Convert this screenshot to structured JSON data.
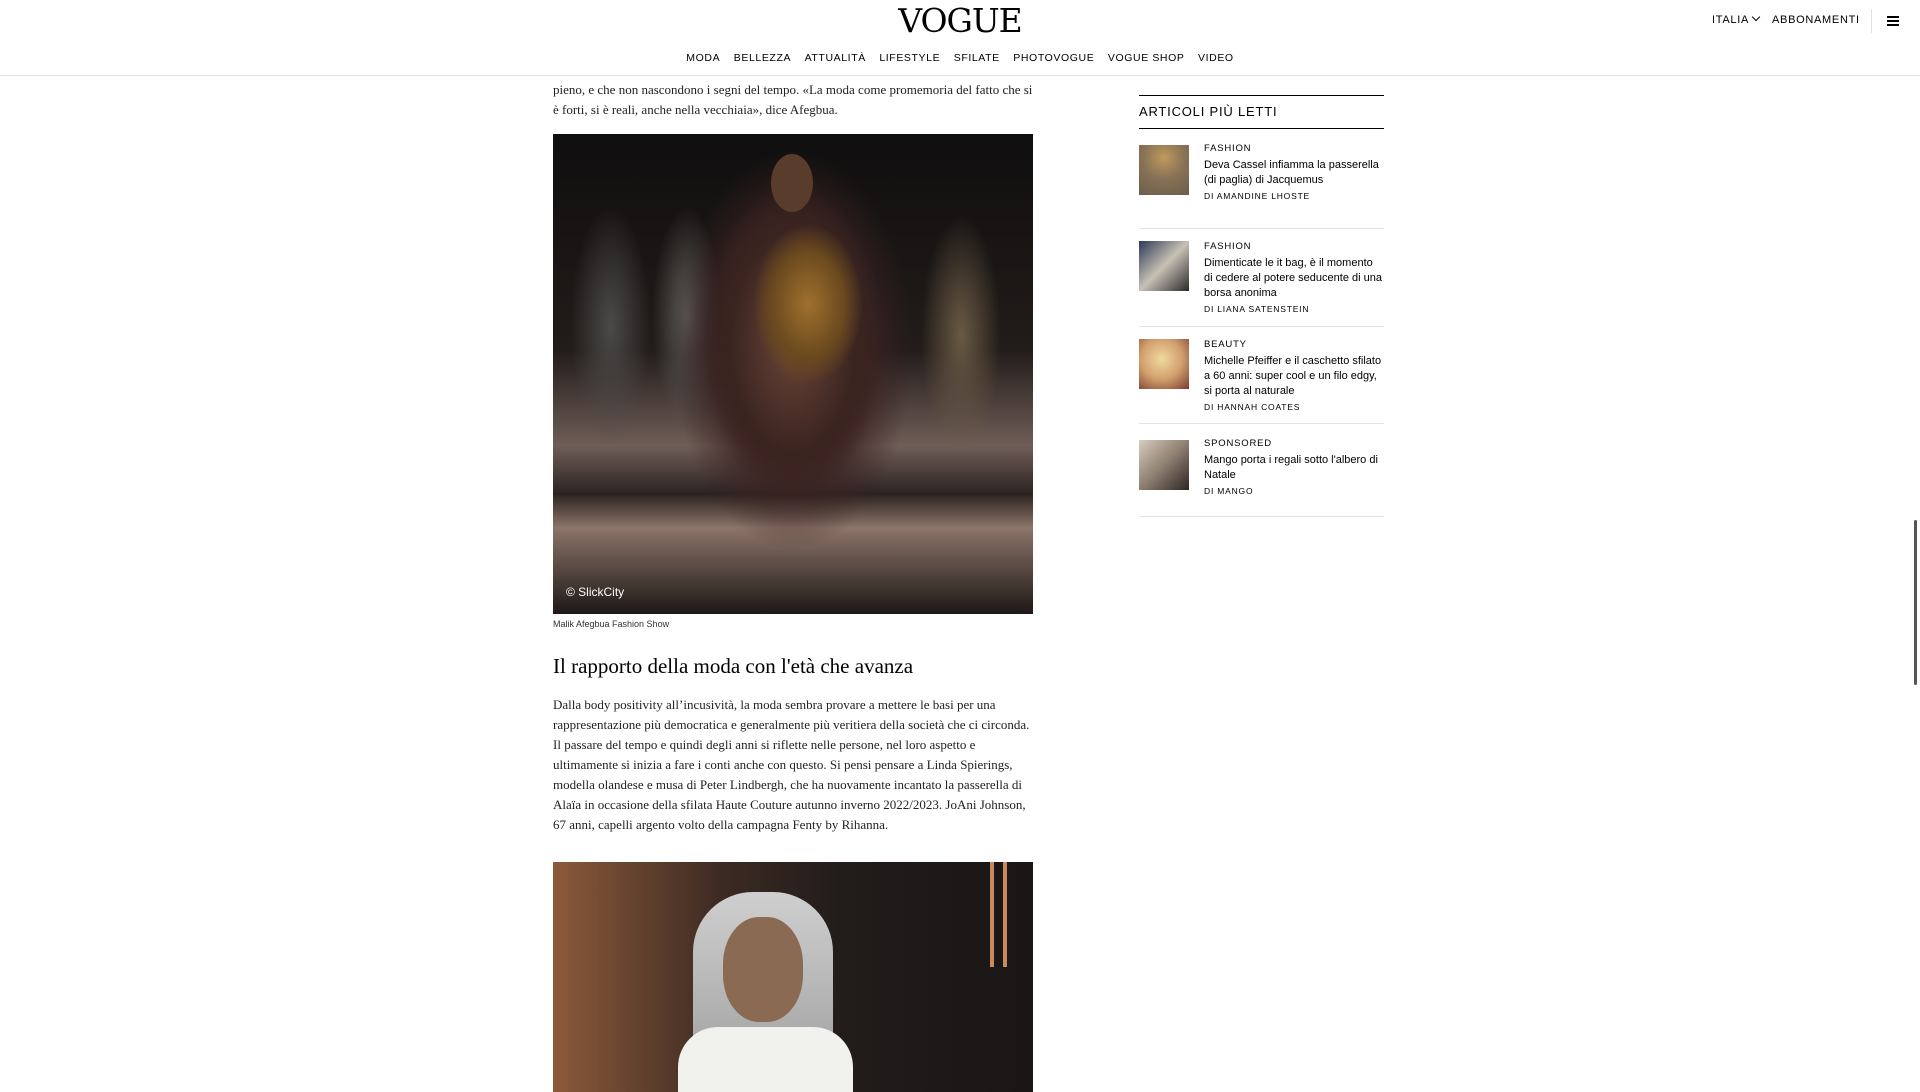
{
  "header": {
    "logo": "VOGUE",
    "country": "ITALIA",
    "subscribe": "ABBONAMENTI"
  },
  "nav": {
    "items": [
      "MODA",
      "BELLEZZA",
      "ATTUALITÀ",
      "LIFESTYLE",
      "SFILATE",
      "PHOTOVOGUE",
      "VOGUE SHOP",
      "VIDEO"
    ]
  },
  "article": {
    "intro_text": "pieno, e che non nascondono i segni del tempo. «La moda come promemoria del fatto che si è forti, si è reali, anche nella vecchiaia», dice Afegbua.",
    "photo1": {
      "credit": "© SlickCity",
      "caption": "Malik Afegbua Fashion Show"
    },
    "heading": "Il rapporto della moda con l'età che avanza",
    "paragraph": "Dalla body positivity all’incusività, la moda sembra provare a mettere le basi per una rappresentazione più democratica e generalmente più veritiera della società che ci circonda. Il passare del tempo e quindi degli anni si riflette nelle persone, nel loro aspetto e ultimamente si inizia a fare i conti anche con questo. Si pensi pensare a Linda Spierings, modella olandese e musa di Peter Lindbergh, che ha nuovamente incantato la passerella di Alaïa in occasione della sfilata Haute Couture autunno inverno 2022/2023. JoAni Johnson, 67 anni, capelli argento volto della campagna Fenty by Rihanna."
  },
  "sidebar": {
    "title": "ARTICOLI PIÙ LETTI",
    "items": [
      {
        "category": "FASHION",
        "title": "Deva Cassel infiamma la passerella (di paglia) di Jacquemus",
        "author": "DI AMANDINE LHOSTE"
      },
      {
        "category": "FASHION",
        "title": "Dimenticate le it bag, è il momento di cedere al potere seducente di una borsa anonima",
        "author": "DI LIANA SATENSTEIN"
      },
      {
        "category": "BEAUTY",
        "title": "Michelle Pfeiffer e il caschetto sfilato a 60 anni: super cool e un filo edgy, si porta al naturale",
        "author": "DI HANNAH COATES"
      },
      {
        "category": "SPONSORED",
        "title": "Mango porta i regali sotto l'albero di Natale",
        "author": "DI MANGO"
      }
    ]
  }
}
